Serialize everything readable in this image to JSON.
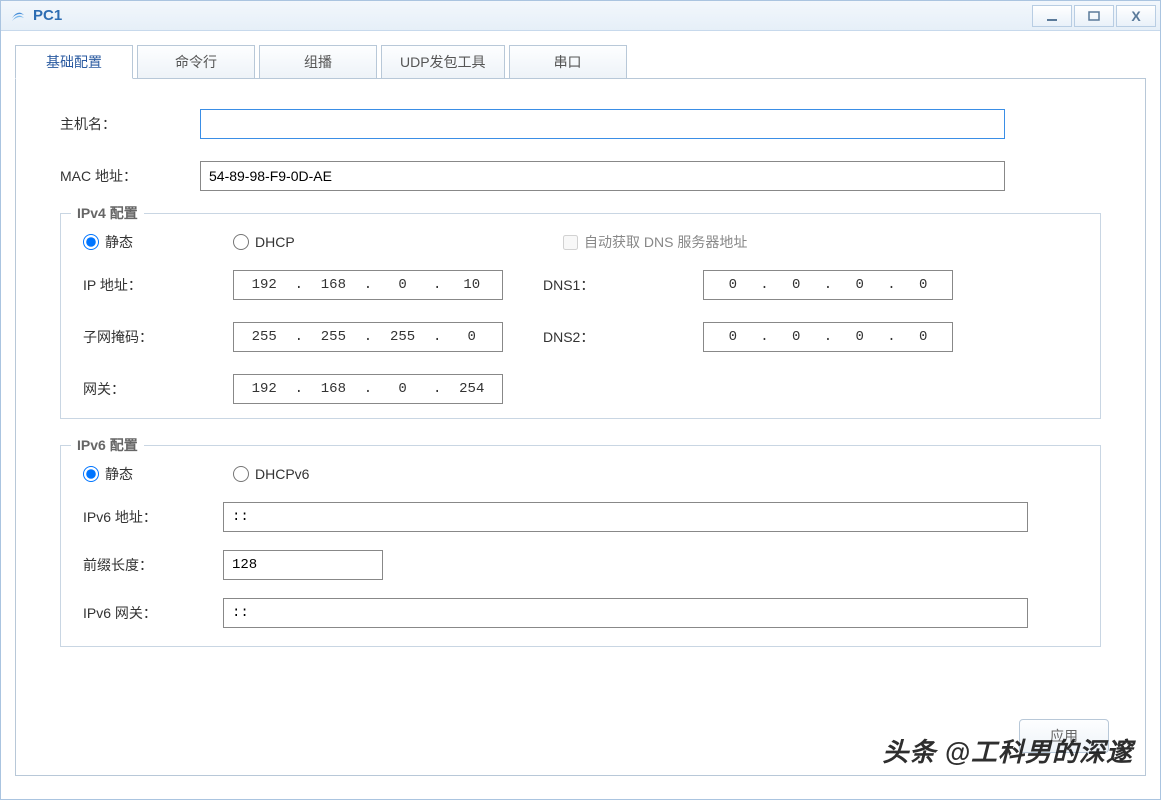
{
  "window": {
    "title": "PC1"
  },
  "tabs": {
    "basic": "基础配置",
    "cmd": "命令行",
    "mcast": "组播",
    "udp": "UDP发包工具",
    "serial": "串口"
  },
  "basic": {
    "hostname_label": "主机名：",
    "hostname_value": "",
    "mac_label": "MAC 地址：",
    "mac_value": "54-89-98-F9-0D-AE"
  },
  "ipv4": {
    "legend": "IPv4 配置",
    "static_label": "静态",
    "dhcp_label": "DHCP",
    "auto_dns_label": "自动获取 DNS 服务器地址",
    "ip_label": "IP 地址：",
    "ip": [
      "192",
      "168",
      "0",
      "10"
    ],
    "mask_label": "子网掩码：",
    "mask": [
      "255",
      "255",
      "255",
      "0"
    ],
    "gw_label": "网关：",
    "gw": [
      "192",
      "168",
      "0",
      "254"
    ],
    "dns1_label": "DNS1：",
    "dns1": [
      "0",
      "0",
      "0",
      "0"
    ],
    "dns2_label": "DNS2：",
    "dns2": [
      "0",
      "0",
      "0",
      "0"
    ]
  },
  "ipv6": {
    "legend": "IPv6 配置",
    "static_label": "静态",
    "dhcp_label": "DHCPv6",
    "addr_label": "IPv6 地址：",
    "addr_value": "::",
    "prefix_label": "前缀长度：",
    "prefix_value": "128",
    "gw_label": "IPv6 网关：",
    "gw_value": "::"
  },
  "buttons": {
    "apply": "应用"
  },
  "watermark": "头条 @工科男的深邃"
}
